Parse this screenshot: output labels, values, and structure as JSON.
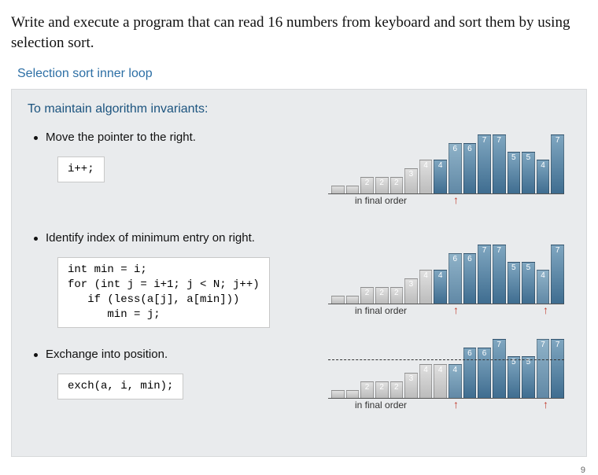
{
  "prompt": "Write and execute a program that can read 16 numbers from keyboard and sort them by using selection sort.",
  "section_title": "Selection sort inner loop",
  "panel_sub": "To maintain algorithm invariants:",
  "steps": {
    "s1": {
      "text": "Move the pointer to the right.",
      "code": "i++;",
      "final": "in final order"
    },
    "s2": {
      "text": "Identify index of minimum entry on right.",
      "code": "int min = i;\nfor (int j = i+1; j < N; j++)\n   if (less(a[j], a[min]))\n      min = j;",
      "final": "in final order"
    },
    "s3": {
      "text": "Exchange into position.",
      "code": "exch(a, i, min);",
      "final": "in final order"
    }
  },
  "page_number": "9",
  "chart_data": [
    {
      "id": "c1",
      "type": "bar",
      "title": "step1",
      "ylim": [
        0,
        8
      ],
      "sorted_upto": 7,
      "arrows": [
        8
      ],
      "values": [
        1,
        1,
        2,
        2,
        2,
        3,
        4,
        4,
        6,
        6,
        7,
        7,
        5,
        5,
        4,
        7
      ],
      "labels": [
        "",
        "",
        "2",
        "2",
        "2",
        "3",
        "4",
        "4",
        "6",
        "6",
        "7",
        "7",
        "5",
        "5",
        "4",
        "7"
      ],
      "final_label": "in final order"
    },
    {
      "id": "c2",
      "type": "bar",
      "title": "step2",
      "ylim": [
        0,
        8
      ],
      "sorted_upto": 7,
      "arrows": [
        8,
        14
      ],
      "values": [
        1,
        1,
        2,
        2,
        2,
        3,
        4,
        4,
        6,
        6,
        7,
        7,
        5,
        5,
        4,
        7
      ],
      "labels": [
        "",
        "",
        "2",
        "2",
        "2",
        "3",
        "4",
        "4",
        "6",
        "6",
        "7",
        "7",
        "5",
        "5",
        "4",
        "7"
      ],
      "final_label": "in final order"
    },
    {
      "id": "c3",
      "type": "bar",
      "title": "step3",
      "ylim": [
        0,
        8
      ],
      "sorted_upto": 8,
      "arrows": [
        8,
        14
      ],
      "dashed": true,
      "values": [
        1,
        1,
        2,
        2,
        2,
        3,
        4,
        4,
        4,
        6,
        6,
        7,
        5,
        5,
        7,
        7
      ],
      "labels": [
        "",
        "",
        "2",
        "2",
        "2",
        "3",
        "4",
        "4",
        "4",
        "6",
        "6",
        "7",
        "5",
        "5",
        "7",
        "7"
      ],
      "final_label": "in final order"
    }
  ]
}
